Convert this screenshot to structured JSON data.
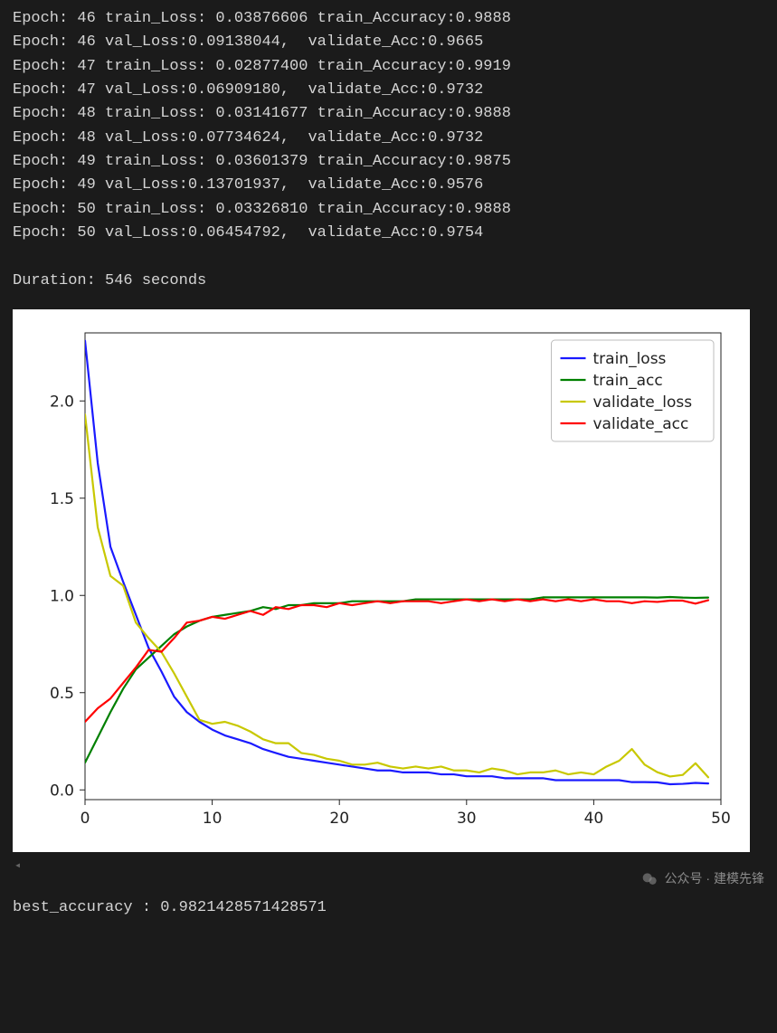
{
  "log_lines": [
    "Epoch: 46 train_Loss: 0.03876606 train_Accuracy:0.9888",
    "Epoch: 46 val_Loss:0.09138044,  validate_Acc:0.9665",
    "Epoch: 47 train_Loss: 0.02877400 train_Accuracy:0.9919",
    "Epoch: 47 val_Loss:0.06909180,  validate_Acc:0.9732",
    "Epoch: 48 train_Loss: 0.03141677 train_Accuracy:0.9888",
    "Epoch: 48 val_Loss:0.07734624,  validate_Acc:0.9732",
    "Epoch: 49 train_Loss: 0.03601379 train_Accuracy:0.9875",
    "Epoch: 49 val_Loss:0.13701937,  validate_Acc:0.9576",
    "Epoch: 50 train_Loss: 0.03326810 train_Accuracy:0.9888",
    "Epoch: 50 val_Loss:0.06454792,  validate_Acc:0.9754"
  ],
  "duration_line": "Duration: 546 seconds",
  "best_line": "best_accuracy : 0.9821428571428571",
  "watermark_text": "公众号 · 建模先锋",
  "chart_data": {
    "type": "line",
    "title": "",
    "xlabel": "",
    "ylabel": "",
    "xlim": [
      0,
      50
    ],
    "ylim": [
      -0.05,
      2.35
    ],
    "xticks": [
      0,
      10,
      20,
      30,
      40,
      50
    ],
    "yticks": [
      0.0,
      0.5,
      1.0,
      1.5,
      2.0
    ],
    "legend_position": "upper right",
    "x": [
      0,
      1,
      2,
      3,
      4,
      5,
      6,
      7,
      8,
      9,
      10,
      11,
      12,
      13,
      14,
      15,
      16,
      17,
      18,
      19,
      20,
      21,
      22,
      23,
      24,
      25,
      26,
      27,
      28,
      29,
      30,
      31,
      32,
      33,
      34,
      35,
      36,
      37,
      38,
      39,
      40,
      41,
      42,
      43,
      44,
      45,
      46,
      47,
      48,
      49
    ],
    "series": [
      {
        "name": "train_loss",
        "color": "#1a1aff",
        "values": [
          2.31,
          1.68,
          1.25,
          1.07,
          0.9,
          0.73,
          0.61,
          0.48,
          0.4,
          0.35,
          0.31,
          0.28,
          0.26,
          0.24,
          0.21,
          0.19,
          0.17,
          0.16,
          0.15,
          0.14,
          0.13,
          0.12,
          0.11,
          0.1,
          0.1,
          0.09,
          0.09,
          0.09,
          0.08,
          0.08,
          0.07,
          0.07,
          0.07,
          0.06,
          0.06,
          0.06,
          0.06,
          0.05,
          0.05,
          0.05,
          0.05,
          0.05,
          0.05,
          0.04,
          0.04,
          0.039,
          0.029,
          0.031,
          0.036,
          0.033
        ]
      },
      {
        "name": "train_acc",
        "color": "#008000",
        "values": [
          0.14,
          0.27,
          0.4,
          0.52,
          0.62,
          0.68,
          0.74,
          0.8,
          0.84,
          0.87,
          0.89,
          0.9,
          0.91,
          0.92,
          0.94,
          0.93,
          0.95,
          0.95,
          0.96,
          0.96,
          0.96,
          0.97,
          0.97,
          0.97,
          0.97,
          0.97,
          0.98,
          0.98,
          0.98,
          0.98,
          0.98,
          0.98,
          0.98,
          0.98,
          0.98,
          0.98,
          0.99,
          0.99,
          0.99,
          0.99,
          0.99,
          0.99,
          0.99,
          0.99,
          0.99,
          0.9888,
          0.9919,
          0.9888,
          0.9875,
          0.9888
        ]
      },
      {
        "name": "validate_loss",
        "color": "#c8c800",
        "values": [
          1.93,
          1.35,
          1.1,
          1.05,
          0.86,
          0.78,
          0.71,
          0.6,
          0.48,
          0.36,
          0.34,
          0.35,
          0.33,
          0.3,
          0.26,
          0.24,
          0.24,
          0.19,
          0.18,
          0.16,
          0.15,
          0.13,
          0.13,
          0.14,
          0.12,
          0.11,
          0.12,
          0.11,
          0.12,
          0.1,
          0.1,
          0.09,
          0.11,
          0.1,
          0.08,
          0.09,
          0.09,
          0.1,
          0.08,
          0.09,
          0.08,
          0.12,
          0.15,
          0.21,
          0.13,
          0.091,
          0.069,
          0.077,
          0.137,
          0.065
        ]
      },
      {
        "name": "validate_acc",
        "color": "#ff0000",
        "values": [
          0.35,
          0.42,
          0.47,
          0.55,
          0.63,
          0.72,
          0.71,
          0.78,
          0.86,
          0.87,
          0.89,
          0.88,
          0.9,
          0.92,
          0.9,
          0.94,
          0.93,
          0.95,
          0.95,
          0.94,
          0.96,
          0.95,
          0.96,
          0.97,
          0.96,
          0.97,
          0.97,
          0.97,
          0.96,
          0.97,
          0.98,
          0.97,
          0.98,
          0.97,
          0.98,
          0.97,
          0.98,
          0.97,
          0.98,
          0.97,
          0.98,
          0.97,
          0.97,
          0.96,
          0.97,
          0.9665,
          0.9732,
          0.9732,
          0.9576,
          0.9754
        ]
      }
    ]
  }
}
